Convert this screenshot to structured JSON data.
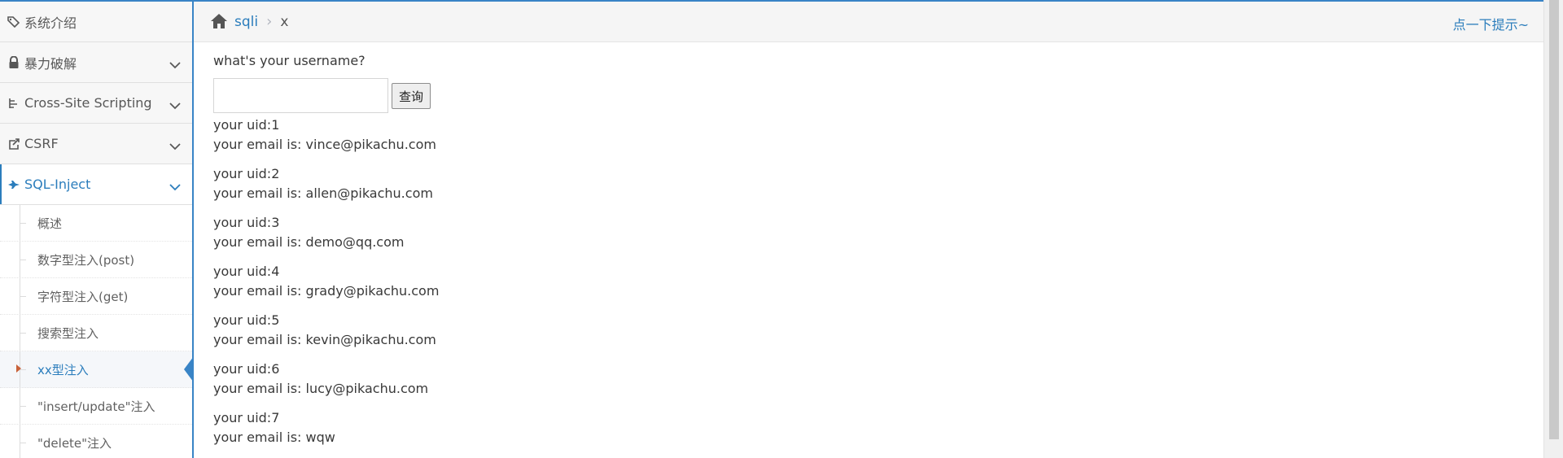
{
  "sidebar": {
    "items": [
      {
        "label": "系统介绍"
      },
      {
        "label": "暴力破解"
      },
      {
        "label": "Cross-Site Scripting"
      },
      {
        "label": "CSRF"
      },
      {
        "label": "SQL-Inject"
      }
    ],
    "submenu": [
      {
        "label": "概述"
      },
      {
        "label": "数字型注入(post)"
      },
      {
        "label": "字符型注入(get)"
      },
      {
        "label": "搜索型注入"
      },
      {
        "label": "xx型注入"
      },
      {
        "label": "\"insert/update\"注入"
      },
      {
        "label": "\"delete\"注入"
      }
    ]
  },
  "breadcrumb": {
    "link": "sqli",
    "separator": "›",
    "current": "x",
    "hint": "点一下提示~"
  },
  "main": {
    "question": "what's your username?",
    "input_value": "",
    "query_button": "查询",
    "results": [
      {
        "uid": "your uid:1",
        "email": "your email is: vince@pikachu.com"
      },
      {
        "uid": "your uid:2",
        "email": "your email is: allen@pikachu.com"
      },
      {
        "uid": "your uid:3",
        "email": "your email is: demo@qq.com"
      },
      {
        "uid": "your uid:4",
        "email": "your email is: grady@pikachu.com"
      },
      {
        "uid": "your uid:5",
        "email": "your email is: kevin@pikachu.com"
      },
      {
        "uid": "your uid:6",
        "email": "your email is: lucy@pikachu.com"
      },
      {
        "uid": "your uid:7",
        "email": "your email is: wqw"
      }
    ]
  },
  "colors": {
    "accent": "#2b7dbc",
    "border_blue": "#3984c6",
    "caret": "#c86139"
  }
}
